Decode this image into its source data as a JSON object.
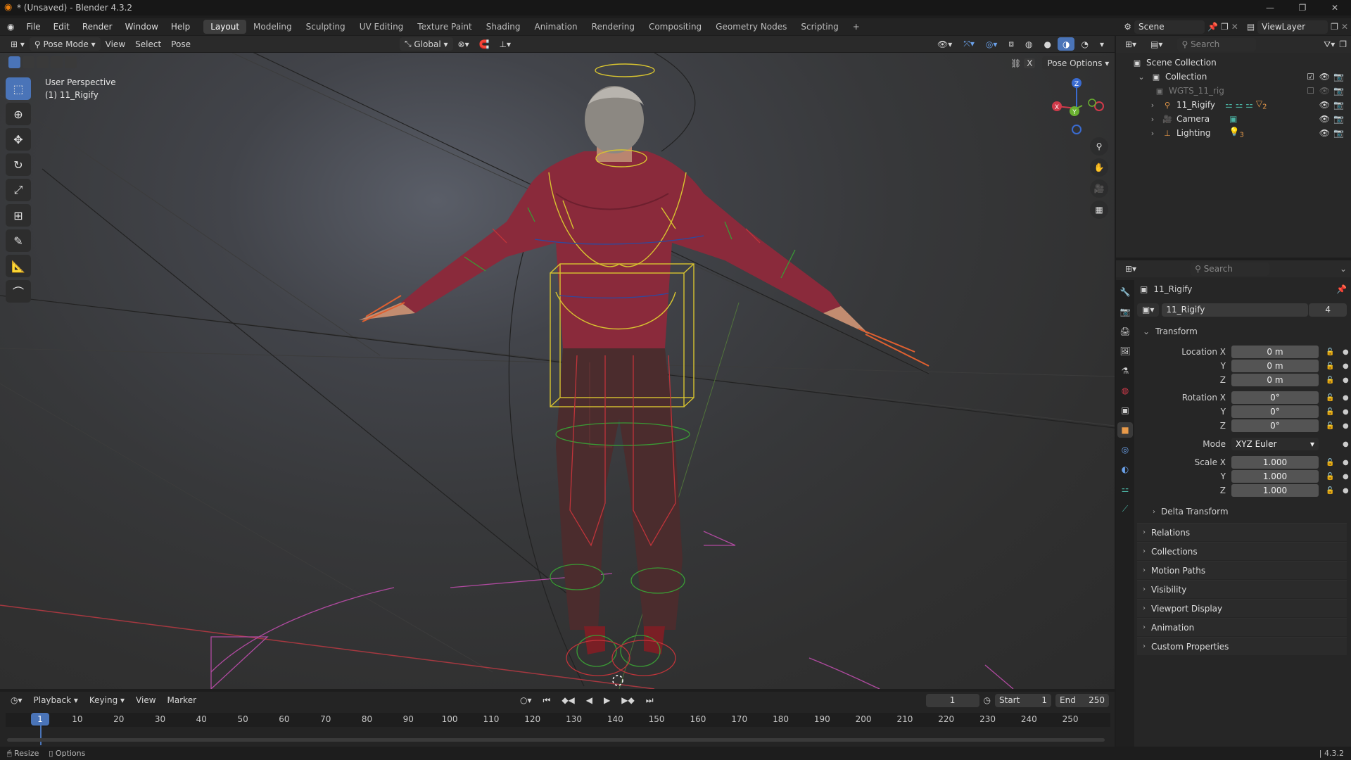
{
  "window": {
    "title": "* (Unsaved) - Blender 4.3.2"
  },
  "menu": [
    "File",
    "Edit",
    "Render",
    "Window",
    "Help"
  ],
  "workspaces": [
    "Layout",
    "Modeling",
    "Sculpting",
    "UV Editing",
    "Texture Paint",
    "Shading",
    "Animation",
    "Rendering",
    "Compositing",
    "Geometry Nodes",
    "Scripting",
    "+"
  ],
  "active_workspace": "Layout",
  "scene": {
    "name": "Scene",
    "view_layer": "ViewLayer"
  },
  "viewport_header": {
    "mode": "Pose Mode",
    "view": "View",
    "select": "Select",
    "pose": "Pose",
    "orientation": "Global",
    "pose_options": "Pose Options",
    "x_label": "X"
  },
  "viewport": {
    "perspective": "User Perspective",
    "object": "(1) 11_Rigify"
  },
  "gizmo": {
    "x": "X",
    "y": "Y",
    "z": "Z"
  },
  "outliner": {
    "search_placeholder": "Search",
    "scene_collection": "Scene Collection",
    "items": [
      {
        "label": "Collection",
        "icon": "collection-icon",
        "indent": 1
      },
      {
        "label": "WGTS_11_rig",
        "icon": "collection-icon",
        "indent": 2,
        "dim": true
      },
      {
        "label": "11_Rigify",
        "icon": "armature-icon",
        "indent": 2
      },
      {
        "label": "Camera",
        "icon": "camera-icon",
        "indent": 2
      },
      {
        "label": "Lighting",
        "icon": "empty-icon",
        "indent": 2
      }
    ],
    "badge_rigify": "2",
    "badge_lighting": "3"
  },
  "properties": {
    "search_placeholder": "Search",
    "object_name": "11_Rigify",
    "datablock_name": "11_Rigify",
    "users": "4",
    "transform": {
      "header": "Transform",
      "location_label": "Location X",
      "y_label": "Y",
      "z_label": "Z",
      "location": [
        "0 m",
        "0 m",
        "0 m"
      ],
      "rotation_label": "Rotation X",
      "rotation": [
        "0°",
        "0°",
        "0°"
      ],
      "mode_label": "Mode",
      "mode": "XYZ Euler",
      "scale_label": "Scale X",
      "scale": [
        "1.000",
        "1.000",
        "1.000"
      ]
    },
    "delta": "Delta Transform",
    "sections": [
      "Relations",
      "Collections",
      "Motion Paths",
      "Visibility",
      "Viewport Display",
      "Animation",
      "Custom Properties"
    ]
  },
  "timeline": {
    "playback": "Playback",
    "keying": "Keying",
    "view": "View",
    "marker": "Marker",
    "current_frame": "1",
    "start_label": "Start",
    "start": "1",
    "end_label": "End",
    "end": "250",
    "ticks": [
      "10",
      "20",
      "30",
      "40",
      "50",
      "60",
      "70",
      "80",
      "90",
      "100",
      "110",
      "120",
      "130",
      "140",
      "150",
      "160",
      "170",
      "180",
      "190",
      "200",
      "210",
      "220",
      "230",
      "240",
      "250"
    ]
  },
  "statusbar": {
    "resize": "Resize",
    "options": "Options",
    "version": "4.3.2"
  },
  "colors": {
    "accent": "#4a74b8",
    "panel": "#282828",
    "bg": "#1d1d1d"
  }
}
